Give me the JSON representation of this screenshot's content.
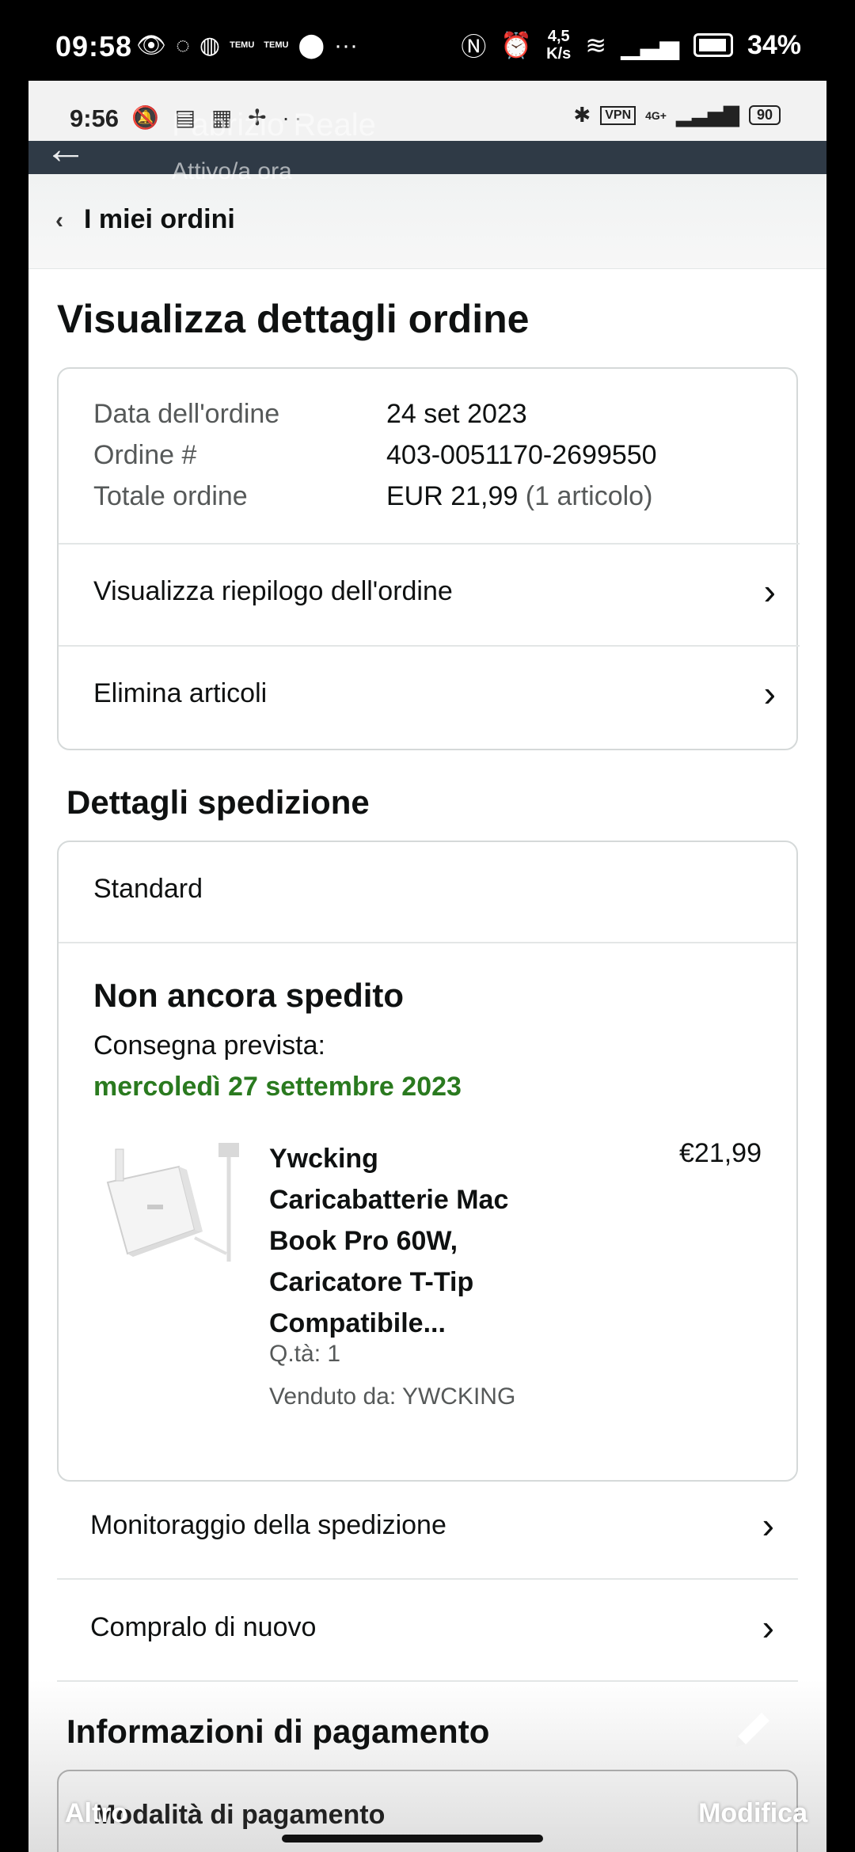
{
  "device_status": {
    "time": "09:58",
    "temu_1": "TEMU",
    "temu_2": "TEMU",
    "speed": "4,5",
    "speed_unit": "K/s",
    "battery": "34%"
  },
  "inner_status": {
    "time": "9:56",
    "vpn": "VPN",
    "network": "4G+",
    "battery": "90"
  },
  "chat_overlay": {
    "contact_name": "Fabrizio Reale",
    "presence": "Attivo/a ora",
    "altro_label": "Altro",
    "modifica_label": "Modifica"
  },
  "breadcrumb": {
    "label": "I miei ordini"
  },
  "page_title": "Visualizza dettagli ordine",
  "order_summary": {
    "date_label": "Data dell'ordine",
    "date_value": "24 set 2023",
    "number_label": "Ordine #",
    "number_value": "403-0051170-2699550",
    "total_label": "Totale ordine",
    "total_value": "EUR 21,99",
    "total_items": "(1 articolo)",
    "links": [
      {
        "label": "Visualizza riepilogo dell'ordine"
      },
      {
        "label": "Elimina articoli"
      }
    ]
  },
  "shipping": {
    "section_title": "Dettagli spedizione",
    "method": "Standard",
    "status": "Non ancora spedito",
    "delivery_label": "Consegna prevista:",
    "delivery_date": "mercoledì 27 settembre 2023",
    "product": {
      "title": "Ywcking Caricabatterie Mac Book Pro 60W, Caricatore T-Tip Compatibile...",
      "price": "€21,99",
      "quantity": "Q.tà: 1",
      "seller": "Venduto da: YWCKING"
    }
  },
  "actions": [
    {
      "label": "Monitoraggio della spedizione"
    },
    {
      "label": "Compralo di nuovo"
    }
  ],
  "payment": {
    "section_title": "Informazioni di pagamento",
    "method_label": "Modalità di pagamento"
  },
  "colors": {
    "delivery_green": "#2a7a1f",
    "chat_header": "#2f3a46"
  }
}
